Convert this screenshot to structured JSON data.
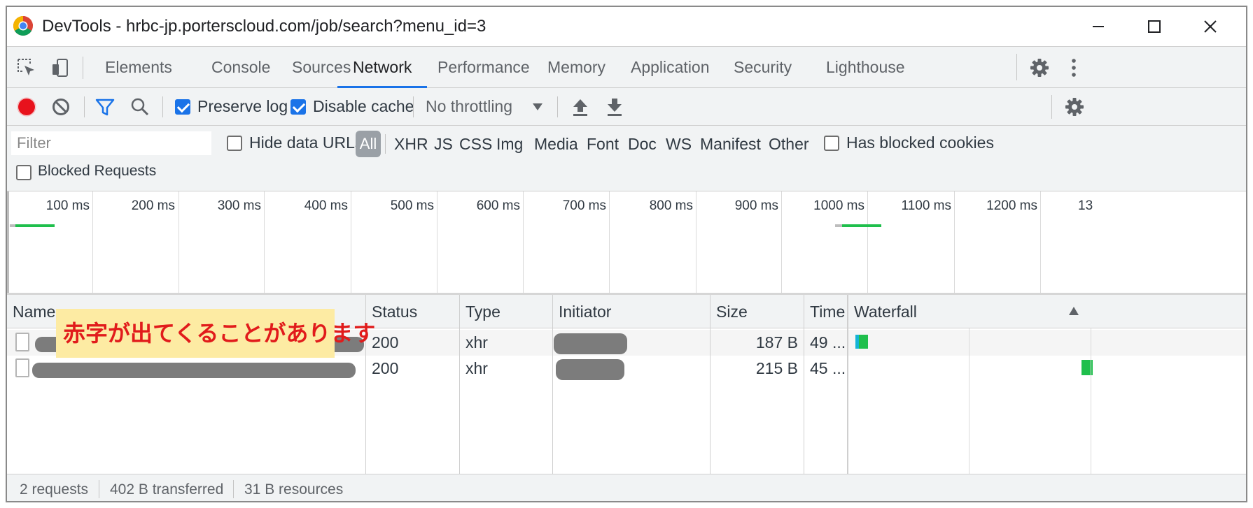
{
  "window": {
    "title": "DevTools - hrbc-jp.porterscloud.com/job/search?menu_id=3",
    "icons": {
      "app": "chrome-icon",
      "minimize": "minimize-icon",
      "maximize": "maximize-icon",
      "close": "close-icon"
    }
  },
  "tabs": [
    {
      "label": "Elements"
    },
    {
      "label": "Console"
    },
    {
      "label": "Sources"
    },
    {
      "label": "Network",
      "active": true
    },
    {
      "label": "Performance"
    },
    {
      "label": "Memory"
    },
    {
      "label": "Application"
    },
    {
      "label": "Security"
    },
    {
      "label": "Lighthouse"
    }
  ],
  "toolbar": {
    "preserve_log": {
      "label": "Preserve log",
      "checked": true
    },
    "disable_cache": {
      "label": "Disable cache",
      "checked": true
    },
    "throttling": "No throttling",
    "icons": [
      "record-icon",
      "clear-icon",
      "filter-icon",
      "search-icon",
      "upload-icon",
      "download-icon",
      "settings-icon"
    ]
  },
  "filterbar": {
    "filter_placeholder": "Filter",
    "hide_data_urls": {
      "label": "Hide data URLs",
      "checked": false
    },
    "types": [
      "All",
      "XHR",
      "JS",
      "CSS",
      "Img",
      "Media",
      "Font",
      "Doc",
      "WS",
      "Manifest",
      "Other"
    ],
    "active_type": "All",
    "has_blocked_cookies": {
      "label": "Has blocked cookies",
      "checked": false
    },
    "blocked_requests": {
      "label": "Blocked Requests",
      "checked": false
    }
  },
  "overview": {
    "ticks": [
      "100 ms",
      "200 ms",
      "300 ms",
      "400 ms",
      "500 ms",
      "600 ms",
      "700 ms",
      "800 ms",
      "900 ms",
      "1000 ms",
      "1100 ms",
      "1200 ms",
      "13"
    ]
  },
  "table": {
    "columns": [
      "Name",
      "Status",
      "Type",
      "Initiator",
      "Size",
      "Time",
      "Waterfall"
    ],
    "rows": [
      {
        "status": "200",
        "type": "xhr",
        "size": "187 B",
        "time": "49 ..."
      },
      {
        "status": "200",
        "type": "xhr",
        "size": "215 B",
        "time": "45 ..."
      }
    ],
    "callout": "赤字が出てくることがあります"
  },
  "statusbar": {
    "requests": "2 requests",
    "transferred": "402 B transferred",
    "resources": "31 B resources"
  },
  "colors": {
    "accent": "#1a73e8",
    "record": "#e8121c",
    "bar_green": "#1fbf4c",
    "callout_bg": "#fdeba3",
    "callout_text": "#e11b1b"
  }
}
